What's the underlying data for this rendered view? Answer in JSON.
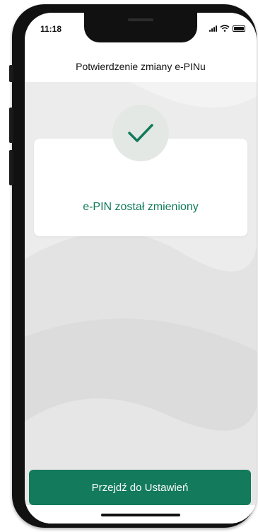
{
  "status_bar": {
    "time": "11:18"
  },
  "header": {
    "title": "Potwierdzenie zmiany e-PINu"
  },
  "card": {
    "icon": "checkmark-icon",
    "message": "e-PIN został zmieniony"
  },
  "footer": {
    "button_label": "Przejdź do Ustawień"
  },
  "colors": {
    "accent": "#137a5b",
    "text_accent": "#127a5a",
    "background": "#ececec"
  }
}
